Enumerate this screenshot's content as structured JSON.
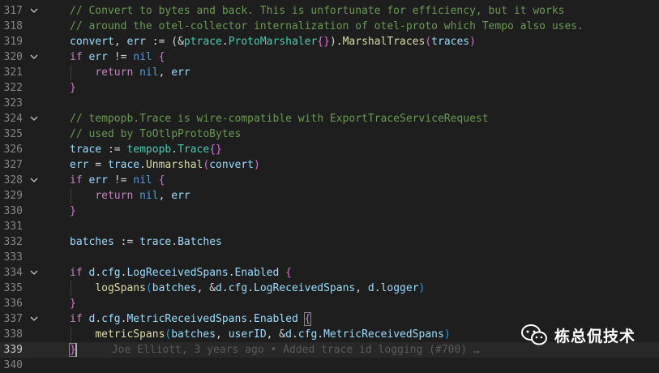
{
  "lines": [
    {
      "num": "317",
      "fold": true,
      "html": "<span class='c-comment'>// Convert to bytes and back. This is unfortunate for efficiency, but it works</span>"
    },
    {
      "num": "318",
      "fold": false,
      "html": "<span class='c-comment'>// around the otel-collector internalization of otel-proto which Tempo also uses.</span>"
    },
    {
      "num": "319",
      "fold": false,
      "html": "<span class='c-var'>convert</span><span class='c-txt'>, </span><span class='c-var'>err</span><span class='c-txt'> := (&amp;</span><span class='c-type'>ptrace</span><span class='c-txt'>.</span><span class='c-type'>ProtoMarshaler</span><span class='c-b2'>{}</span><span class='c-txt'>).</span><span class='c-fn'>MarshalTraces</span><span class='c-b2'>(</span><span class='c-var'>traces</span><span class='c-b2'>)</span>"
    },
    {
      "num": "320",
      "fold": true,
      "html": "<span class='c-kw'>if</span><span class='c-txt'> </span><span class='c-var'>err</span><span class='c-txt'> != </span><span class='c-const'>nil</span><span class='c-txt'> </span><span class='c-b2'>{</span>"
    },
    {
      "num": "321",
      "fold": false,
      "html": "<span class='c-txt'>    </span><span class='c-kw'>return</span><span class='c-txt'> </span><span class='c-const'>nil</span><span class='c-txt'>, </span><span class='c-var'>err</span>"
    },
    {
      "num": "322",
      "fold": false,
      "html": "<span class='c-b2'>}</span>"
    },
    {
      "num": "323",
      "fold": false,
      "html": ""
    },
    {
      "num": "324",
      "fold": true,
      "html": "<span class='c-comment'>// tempopb.Trace is wire-compatible with ExportTraceServiceRequest</span>"
    },
    {
      "num": "325",
      "fold": false,
      "html": "<span class='c-comment'>// used by ToOtlpProtoBytes</span>"
    },
    {
      "num": "326",
      "fold": false,
      "html": "<span class='c-var'>trace</span><span class='c-txt'> := </span><span class='c-type'>tempopb</span><span class='c-txt'>.</span><span class='c-type'>Trace</span><span class='c-b2'>{}</span>"
    },
    {
      "num": "327",
      "fold": false,
      "html": "<span class='c-var'>err</span><span class='c-txt'> = </span><span class='c-var'>trace</span><span class='c-txt'>.</span><span class='c-fn'>Unmarshal</span><span class='c-b2'>(</span><span class='c-var'>convert</span><span class='c-b2'>)</span>"
    },
    {
      "num": "328",
      "fold": true,
      "html": "<span class='c-kw'>if</span><span class='c-txt'> </span><span class='c-var'>err</span><span class='c-txt'> != </span><span class='c-const'>nil</span><span class='c-txt'> </span><span class='c-b2'>{</span>"
    },
    {
      "num": "329",
      "fold": false,
      "html": "<span class='c-txt'>    </span><span class='c-kw'>return</span><span class='c-txt'> </span><span class='c-const'>nil</span><span class='c-txt'>, </span><span class='c-var'>err</span>"
    },
    {
      "num": "330",
      "fold": false,
      "html": "<span class='c-b2'>}</span>"
    },
    {
      "num": "331",
      "fold": false,
      "html": ""
    },
    {
      "num": "332",
      "fold": false,
      "html": "<span class='c-var'>batches</span><span class='c-txt'> := </span><span class='c-var'>trace</span><span class='c-txt'>.</span><span class='c-var'>Batches</span>"
    },
    {
      "num": "333",
      "fold": false,
      "html": ""
    },
    {
      "num": "334",
      "fold": true,
      "html": "<span class='c-kw'>if</span><span class='c-txt'> </span><span class='c-var'>d</span><span class='c-txt'>.</span><span class='c-var'>cfg</span><span class='c-txt'>.</span><span class='c-var'>LogReceivedSpans</span><span class='c-txt'>.</span><span class='c-var'>Enabled</span><span class='c-txt'> </span><span class='c-b2'>{</span>"
    },
    {
      "num": "335",
      "fold": false,
      "html": "<span class='c-txt'>    </span><span class='c-fn'>logSpans</span><span class='c-b3'>(</span><span class='c-var'>batches</span><span class='c-txt'>, &amp;</span><span class='c-var'>d</span><span class='c-txt'>.</span><span class='c-var'>cfg</span><span class='c-txt'>.</span><span class='c-var'>LogReceivedSpans</span><span class='c-txt'>, </span><span class='c-var'>d</span><span class='c-txt'>.</span><span class='c-var'>logger</span><span class='c-b3'>)</span>"
    },
    {
      "num": "336",
      "fold": false,
      "html": "<span class='c-b2'>}</span>"
    },
    {
      "num": "337",
      "fold": true,
      "html": "<span class='c-kw'>if</span><span class='c-txt'> </span><span class='c-var'>d</span><span class='c-txt'>.</span><span class='c-var'>cfg</span><span class='c-txt'>.</span><span class='c-var'>MetricReceivedSpans</span><span class='c-txt'>.</span><span class='c-var'>Enabled</span><span class='c-txt'> </span><span class='c-b2 bracket-match'>{</span>"
    },
    {
      "num": "338",
      "fold": false,
      "html": "<span class='c-txt'>    </span><span class='c-fn'>metricSpans</span><span class='c-b3'>(</span><span class='c-var'>batches</span><span class='c-txt'>, </span><span class='c-var'>userID</span><span class='c-txt'>, &amp;</span><span class='c-var'>d</span><span class='c-txt'>.</span><span class='c-var'>cfg</span><span class='c-txt'>.</span><span class='c-var'>MetricReceivedSpans</span><span class='c-b3'>)</span>"
    },
    {
      "num": "339",
      "fold": false,
      "current": true,
      "html": "<span class='c-b2 bracket-match'>}</span><span class='blame'>Joe Elliott, 3 years ago • Added trace id logging (#700) …</span>"
    },
    {
      "num": "340",
      "fold": false,
      "html": ""
    }
  ],
  "watermark": {
    "text": "栋总侃技术"
  },
  "colors": {
    "background": "#1e1e1e",
    "current_line": "#282828",
    "line_number": "#858585"
  }
}
